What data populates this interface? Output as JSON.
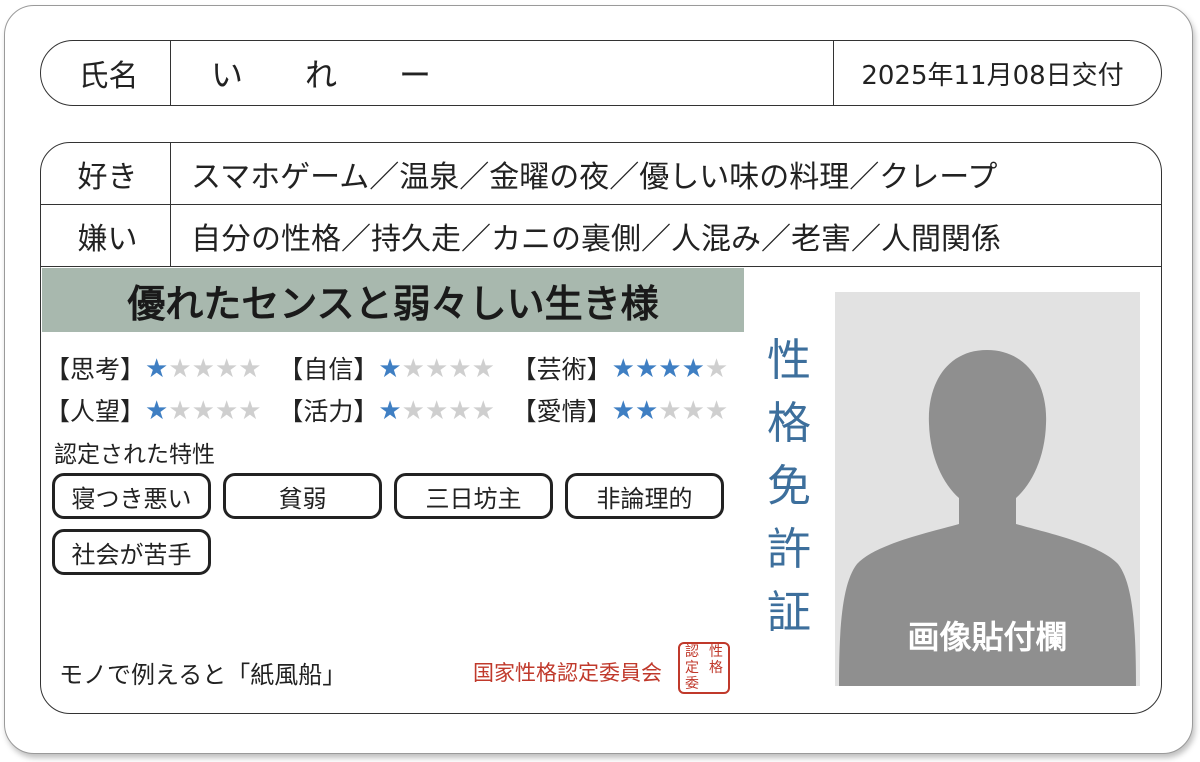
{
  "header": {
    "name_label": "氏名",
    "name_value": "いれー",
    "issue_date": "2025年11月08日交付"
  },
  "likes": {
    "label": "好き",
    "value": "スマホゲーム／温泉／金曜の夜／優しい味の料理／クレープ"
  },
  "dislikes": {
    "label": "嫌い",
    "value": "自分の性格／持久走／カニの裏側／人混み／老害／人間関係"
  },
  "banner": "優れたセンスと弱々しい生き様",
  "stats": [
    {
      "label": "【思考】",
      "rating": 1,
      "max": 5
    },
    {
      "label": "【自信】",
      "rating": 1,
      "max": 5
    },
    {
      "label": "【芸術】",
      "rating": 4,
      "max": 5
    },
    {
      "label": "【人望】",
      "rating": 1,
      "max": 5
    },
    {
      "label": "【活力】",
      "rating": 1,
      "max": 5
    },
    {
      "label": "【愛情】",
      "rating": 2,
      "max": 5
    }
  ],
  "traits_title": "認定された特性",
  "traits": [
    "寝つき悪い",
    "貧弱",
    "三日坊主",
    "非論理的",
    "社会が苦手"
  ],
  "metaphor": "モノで例えると「紙風船」",
  "committee": "国家性格認定委員会",
  "seal_text": "性格認定委",
  "vertical_title": "性格免許証",
  "photo_caption": "画像貼付欄",
  "colors": {
    "star_on": "#3f7fc3",
    "star_off": "#cfcfcf",
    "banner_bg": "#a8b8ae",
    "title_blue": "#3d6f9c",
    "seal_red": "#c0392b",
    "silhouette": "#8f8f8f"
  }
}
